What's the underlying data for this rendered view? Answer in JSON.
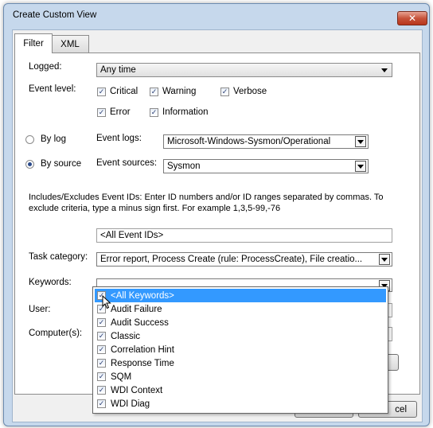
{
  "window": {
    "title": "Create Custom View"
  },
  "tabs": [
    {
      "label": "Filter"
    },
    {
      "label": "XML"
    }
  ],
  "filter": {
    "logged_label": "Logged:",
    "logged_value": "Any time",
    "event_level_label": "Event level:",
    "levels": [
      {
        "label": "Critical",
        "checked": true
      },
      {
        "label": "Warning",
        "checked": true
      },
      {
        "label": "Verbose",
        "checked": true
      },
      {
        "label": "Error",
        "checked": true
      },
      {
        "label": "Information",
        "checked": true
      }
    ],
    "by_log_label": "By log",
    "by_source_label": "By source",
    "selected_mode": "By source",
    "event_logs_label": "Event logs:",
    "event_logs_value": "Microsoft-Windows-Sysmon/Operational",
    "event_sources_label": "Event sources:",
    "event_sources_value": "Sysmon",
    "ids_help": "Includes/Excludes Event IDs: Enter ID numbers and/or ID ranges separated by commas. To exclude criteria, type a minus sign first. For example 1,3,5-99,-76",
    "event_ids_value": "<All Event IDs>",
    "task_category_label": "Task category:",
    "task_category_value": "Error report, Process Create (rule: ProcessCreate), File creatio...",
    "keywords_label": "Keywords:",
    "keywords_value": "",
    "user_label": "User:",
    "computers_label": "Computer(s):"
  },
  "keywords_dropdown": [
    {
      "label": "<All Keywords>",
      "checked": true,
      "selected": true
    },
    {
      "label": "Audit Failure",
      "checked": true
    },
    {
      "label": "Audit Success",
      "checked": true
    },
    {
      "label": "Classic",
      "checked": true
    },
    {
      "label": "Correlation Hint",
      "checked": true
    },
    {
      "label": "Response Time",
      "checked": true
    },
    {
      "label": "SQM",
      "checked": true
    },
    {
      "label": "WDI Context",
      "checked": true
    },
    {
      "label": "WDI Diag",
      "checked": true
    }
  ],
  "buttons": {
    "cancel_partial": "cel"
  },
  "colors": {
    "selection": "#3399ff",
    "close_button": "#c7543b",
    "frame": "#c6d8ec"
  }
}
